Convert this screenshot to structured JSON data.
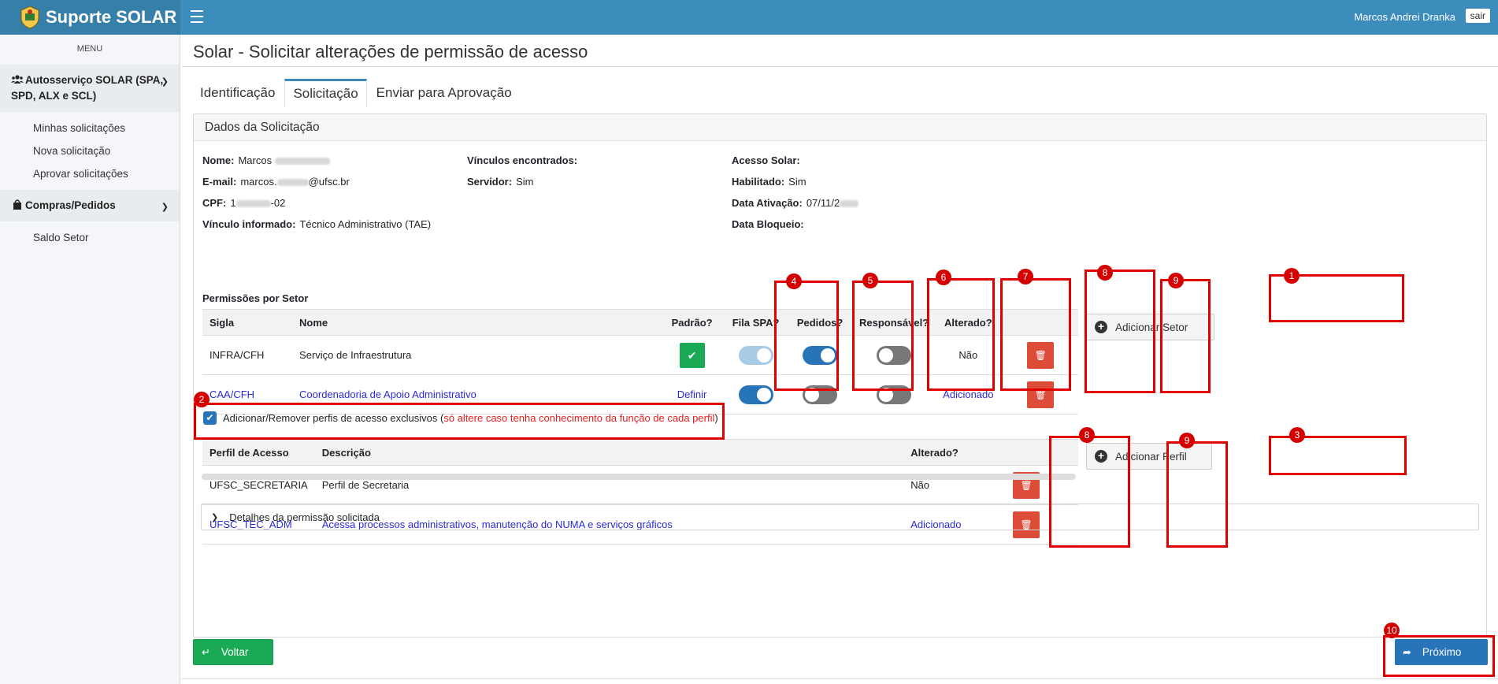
{
  "app": {
    "title": "Suporte SOLAR",
    "user": "Marcos Andrei Dranka",
    "logout_label": "sair"
  },
  "sidebar": {
    "menu_label": "MENU",
    "groups": [
      {
        "label": "Autosserviço SOLAR (SPA, SPD, ALX e SCL)",
        "icon": "users-icon",
        "items": [
          "Minhas solicitações",
          "Nova solicitação",
          "Aprovar solicitações"
        ]
      },
      {
        "label": "Compras/Pedidos",
        "icon": "shopping-bag-icon",
        "items": [
          "Saldo Setor"
        ]
      }
    ]
  },
  "page": {
    "title": "Solar - Solicitar alterações de permissão de acesso"
  },
  "tabs": [
    {
      "label": "Identificação",
      "active": false
    },
    {
      "label": "Solicitação",
      "active": true
    },
    {
      "label": "Enviar para Aprovação",
      "active": false
    }
  ],
  "card": {
    "title": "Dados da Solicitação"
  },
  "info": {
    "nome_label": "Nome:",
    "nome_value": "Marcos",
    "email_label": "E-mail:",
    "email_prefix": "marcos.",
    "email_suffix": "@ufsc.br",
    "cpf_label": "CPF:",
    "cpf_prefix": "1",
    "cpf_suffix": "-02",
    "vinculo_informado_label": "Vínculo informado:",
    "vinculo_informado_value": "Técnico Administrativo (TAE)",
    "vinculos_encontrados_label": "Vínculos encontrados:",
    "servidor_label": "Servidor:",
    "servidor_value": "Sim",
    "acesso_solar_label": "Acesso Solar:",
    "habilitado_label": "Habilitado:",
    "habilitado_value": "Sim",
    "data_ativacao_label": "Data Ativação:",
    "data_ativacao_value": "07/11/2",
    "data_bloqueio_label": "Data Bloqueio:"
  },
  "setores": {
    "section_label": "Permissões por Setor",
    "headers": {
      "sigla": "Sigla",
      "nome": "Nome",
      "padrao": "Padrão?",
      "fila": "Fila SPA?",
      "pedidos": "Pedidos?",
      "responsavel": "Responsável?",
      "alterado": "Alterado?"
    },
    "rows": [
      {
        "sigla": "INFRA/CFH",
        "nome": "Serviço de Infraestrutura",
        "padrao": "checked",
        "fila_spa": "on-disabled",
        "pedidos": "on",
        "responsavel": "off",
        "alterado": "Não"
      },
      {
        "sigla": "CAA/CFH",
        "nome": "Coordenadoria de Apoio Administrativo",
        "padrao": "Definir",
        "fila_spa": "on",
        "pedidos": "off",
        "responsavel": "off",
        "alterado": "Adicionado"
      }
    ],
    "add_button": "Adicionar Setor"
  },
  "perfis": {
    "checkbox_label": "Adicionar/Remover perfis de acesso exclusivos (",
    "checkbox_warning": "só altere caso tenha conhecimento da função de cada perfil",
    "checkbox_close": ")",
    "headers": {
      "perfil": "Perfil de Acesso",
      "descricao": "Descrição",
      "alterado": "Alterado?"
    },
    "rows": [
      {
        "perfil": "UFSC_SECRETARIA",
        "descricao": "Perfil de Secretaria",
        "alterado": "Não"
      },
      {
        "perfil": "UFSC_TEC_ADM",
        "descricao": "Acessa processos administrativos, manutenção do NUMA e serviços gráficos",
        "alterado": "Adicionado"
      }
    ],
    "add_button": "Adicionar Perfil"
  },
  "details": {
    "label": "Detalhes da permissão solicitada"
  },
  "footer": {
    "back_label": "Voltar",
    "next_label": "Próximo"
  },
  "annotations": [
    "1",
    "2",
    "3",
    "4",
    "5",
    "6",
    "7",
    "8",
    "8",
    "9",
    "9",
    "10"
  ],
  "colors": {
    "header": "#3c8dbc",
    "primary": "#2874b8",
    "success": "#1aaa55",
    "danger": "#dd4b39",
    "annotation": "#e00000"
  }
}
